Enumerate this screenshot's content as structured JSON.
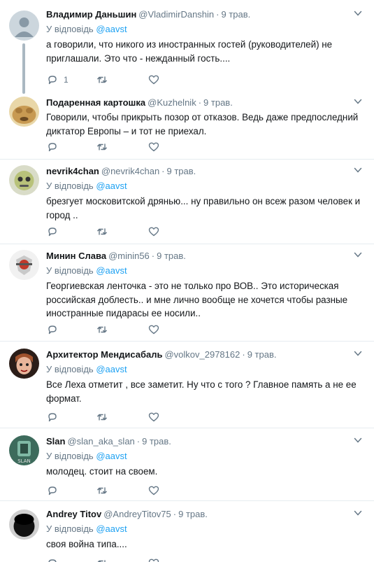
{
  "reply_prefix": "У відповідь",
  "colors": {
    "link": "#1da1f2",
    "muted": "#657786",
    "divider": "#e6ecf0",
    "thread": "#aab8c2"
  },
  "tweets": [
    {
      "name": "Владимир Даньшин",
      "handle": "@VladimirDanshin",
      "time": "9 трав.",
      "reply_to": "@aavst",
      "text": "а говорили, что никого из иностранных гостей (руководителей) не приглашали. Это что - нежданный гость....",
      "reply_count": "1",
      "avatar_icon": "default-avatar-icon"
    },
    {
      "name": "Подаренная картошка",
      "handle": "@Kuzhelnik",
      "time": "9 трав.",
      "text": "Говорили, чтобы прикрыть позор от отказов. Ведь даже предпоследний диктатор Европы – и тот не приехал.",
      "avatar_icon": "dog-avatar-icon"
    },
    {
      "name": "nevrik4chan",
      "handle": "@nevrik4chan",
      "time": "9 трав.",
      "reply_to": "@aavst",
      "text": "брезгует московитской дрянью... ну правильно он всеж разом человек и город ..",
      "avatar_icon": "cartoon-avatar-icon"
    },
    {
      "name": "Минин Слава",
      "handle": "@minin56",
      "time": "9 трав.",
      "reply_to": "@aavst",
      "text": "Георгиевская ленточка - это не только про ВОВ.. Это историческая российская доблесть.. и мне лично вообще не хочется чтобы разные иностранные пидарасы ее носили..",
      "avatar_icon": "emblem-avatar-icon"
    },
    {
      "name": "Архитектор Мендисабаль",
      "handle": "@volkov_2978162",
      "time": "9 трав.",
      "reply_to": "@aavst",
      "text": "Все Леха отметит , все заметит.  Ну что с того ? Главное память а не ее формат.",
      "avatar_icon": "doll-avatar-icon"
    },
    {
      "name": "Slan",
      "handle": "@slan_aka_slan",
      "time": "9 трав.",
      "reply_to": "@aavst",
      "text": "молодец. стоит на своем.",
      "avatar_icon": "slan-avatar-icon"
    },
    {
      "name": "Andrey Titov",
      "handle": "@AndreyTitov75",
      "time": "9 трав.",
      "reply_to": "@aavst",
      "text": "своя война типа....",
      "avatar_icon": "dark-avatar-icon"
    }
  ]
}
